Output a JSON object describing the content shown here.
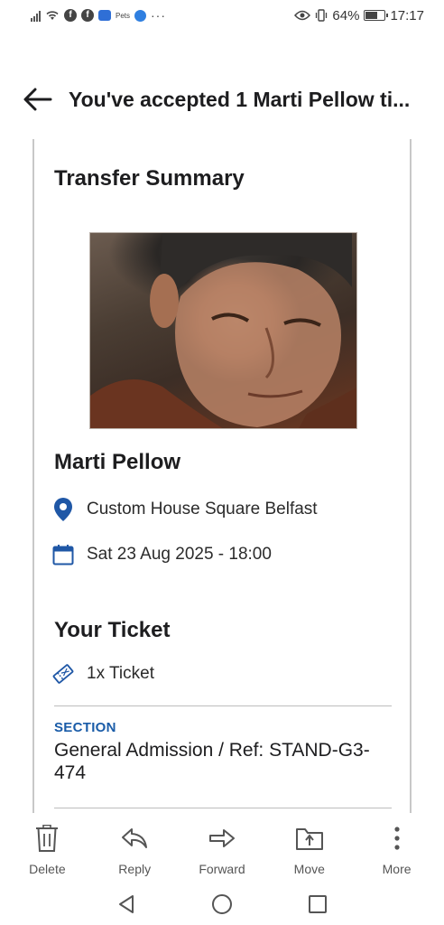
{
  "status_bar": {
    "battery_percent": "64%",
    "time": "17:17",
    "small_icon_text": "Pets",
    "battery_level": 0.64
  },
  "header": {
    "title": "You've accepted 1 Marti Pellow ti..."
  },
  "summary": {
    "title": "Transfer Summary",
    "artist_name": "Marti Pellow",
    "venue": "Custom House Square Belfast",
    "datetime": "Sat 23 Aug 2025 - 18:00"
  },
  "ticket": {
    "title": "Your Ticket",
    "count_label": "1x Ticket",
    "section_label": "SECTION",
    "section_value": "General Admission / Ref: STAND-G3-474"
  },
  "actions": [
    {
      "label": "Delete",
      "icon": "trash-icon"
    },
    {
      "label": "Reply",
      "icon": "reply-icon"
    },
    {
      "label": "Forward",
      "icon": "forward-icon"
    },
    {
      "label": "Move",
      "icon": "move-icon"
    },
    {
      "label": "More",
      "icon": "more-vertical-icon"
    }
  ],
  "colors": {
    "accent_blue": "#1a5ca8",
    "icon_blue": "#1f57a6",
    "text_dark": "#1d1d1f",
    "border": "#c8c8c8"
  }
}
